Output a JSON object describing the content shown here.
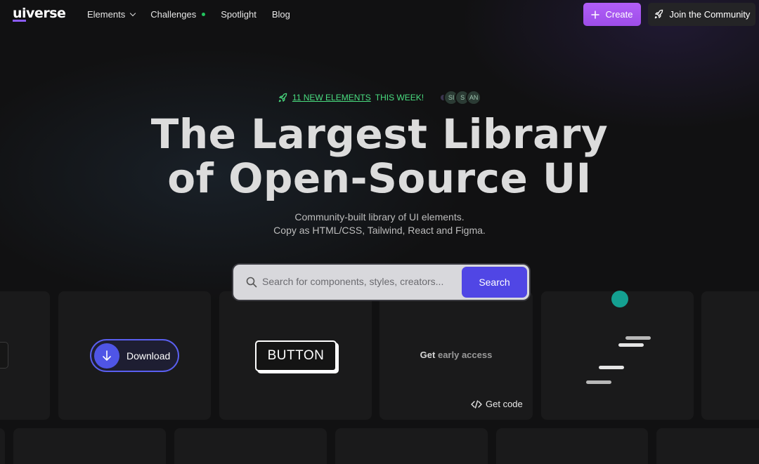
{
  "nav": {
    "logo_ui": "ui",
    "logo_verse": "verse",
    "links": [
      {
        "label": "Elements",
        "has_dropdown": true
      },
      {
        "label": "Challenges",
        "has_dot": true
      },
      {
        "label": "Spotlight"
      },
      {
        "label": "Blog"
      }
    ],
    "create_label": "Create",
    "community_label": "Join the Community"
  },
  "hero": {
    "badge_new": "11 NEW ELEMENTS",
    "badge_week": "THIS WEEK!",
    "avatars": [
      "SI",
      "S",
      "AN"
    ],
    "title_line1": "The Largest Library",
    "title_line2": "of Open-Source UI",
    "subtitle_line1": "Community-built library of UI elements.",
    "subtitle_line2": "Copy as HTML/CSS, Tailwind, React and Figma."
  },
  "search": {
    "placeholder": "Search for components, styles, creators...",
    "button_label": "Search"
  },
  "cards": {
    "download_label": "Download",
    "button_label": "BUTTON",
    "early_get": "Get",
    "early_rest": "early access",
    "get_code_label": "Get code"
  },
  "colors": {
    "accent_purple": "#a855f7",
    "search_button": "#5046e5",
    "badge_green": "#4ade80",
    "teal": "#14b8a6"
  }
}
